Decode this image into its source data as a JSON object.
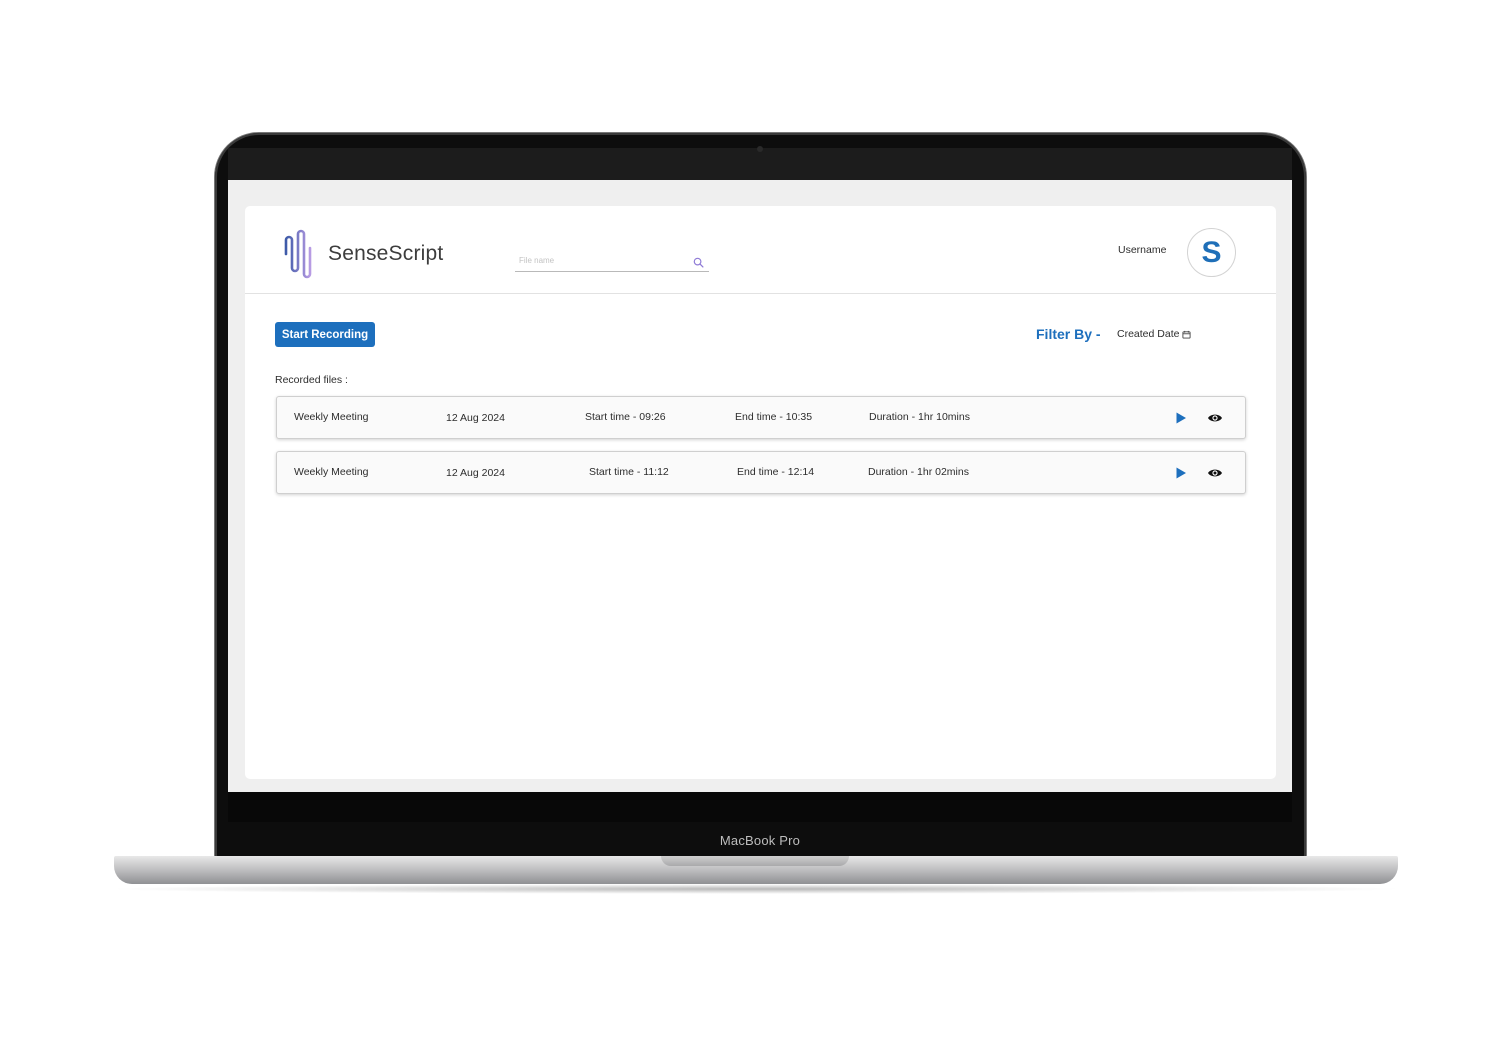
{
  "device": {
    "label": "MacBook Pro"
  },
  "header": {
    "app_name": "SenseScript",
    "search": {
      "placeholder": "File name",
      "value": ""
    },
    "username": "Username",
    "avatar_initial": "S"
  },
  "toolbar": {
    "start_recording_label": "Start Recording",
    "filter_label": "Filter By -",
    "filter_value": "Created Date"
  },
  "files": {
    "section_label": "Recorded files :",
    "items": [
      {
        "title": "Weekly Meeting",
        "date": "12 Aug 2024",
        "start": "Start time - 09:26",
        "end": "End time - 10:35",
        "duration": "Duration - 1hr 10mins"
      },
      {
        "title": "Weekly Meeting",
        "date": "12 Aug 2024",
        "start": "Start time - 11:12",
        "end": "End time - 12:14",
        "duration": "Duration - 1hr 02mins"
      }
    ]
  },
  "icons": {
    "logo": "sound-wave-logo-icon",
    "search": "search-icon",
    "calendar": "calendar-icon",
    "play": "play-icon",
    "view": "eye-icon"
  },
  "colors": {
    "accent": "#1d6fbd",
    "logo_gradient_start": "#3d5aa8",
    "logo_gradient_end": "#b79be3",
    "search_icon": "#8f7bd6",
    "screen_background": "#efefef",
    "card_background": "#ffffff"
  }
}
